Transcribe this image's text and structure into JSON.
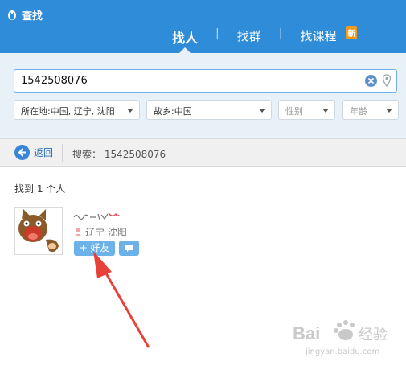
{
  "window": {
    "title": "查找"
  },
  "tabs": [
    {
      "label": "找人",
      "active": true
    },
    {
      "label": "找群",
      "active": false
    },
    {
      "label": "找课程",
      "active": false,
      "badge": "新"
    }
  ],
  "tab_separator": "|",
  "search": {
    "value": "1542508076"
  },
  "filters": [
    {
      "label": "所在地:中国, 辽宁, 沈阳"
    },
    {
      "label": "故乡:中国"
    },
    {
      "label": "性别"
    },
    {
      "label": "年龄"
    }
  ],
  "breadcrumb": {
    "back_label": "返回",
    "summary": "搜索： 1542508076"
  },
  "results": {
    "count_text": "找到 1 个人",
    "items": [
      {
        "location": "辽宁 沈阳",
        "add_label": "+ 好友"
      }
    ]
  },
  "watermark": {
    "brand": "Baidu经验",
    "url": "jingyan.baidu.com"
  },
  "colors": {
    "header": "#2f8cd8",
    "panel": "#e8f0f8",
    "button": "#6cb2e9",
    "annotation_arrow": "#e8413a"
  },
  "icons": [
    "qq-penguin-icon",
    "clear-icon",
    "location-pin-icon",
    "back-arrow-icon",
    "person-icon",
    "message-icon",
    "chevron-down-icon"
  ]
}
